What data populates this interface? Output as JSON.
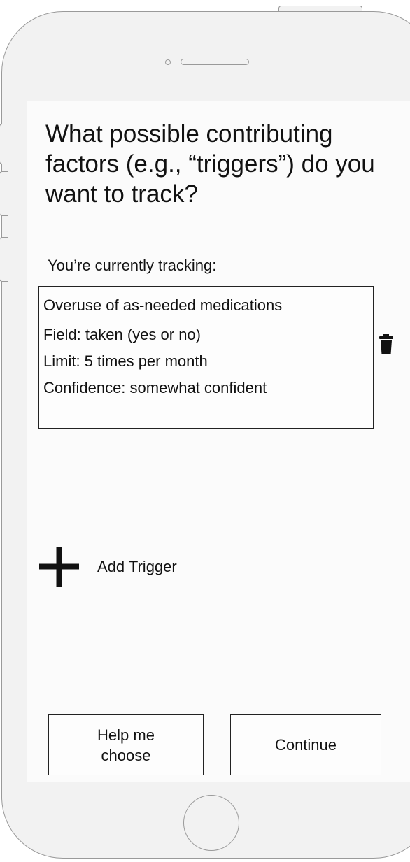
{
  "question": "What possible contributing factors (e.g., “triggers”) do you want to track?",
  "tracking_label": "You’re currently tracking:",
  "tracker": {
    "name": "Overuse of as-needed medications",
    "details": [
      "Field: taken (yes or no)",
      "Limit: 5 times per month",
      "Confidence: somewhat confident"
    ],
    "delete_icon": "trash-icon"
  },
  "add_trigger": {
    "icon": "plus-icon",
    "label": "Add Trigger"
  },
  "buttons": {
    "help_label": "Help me choose",
    "continue_label": "Continue"
  }
}
